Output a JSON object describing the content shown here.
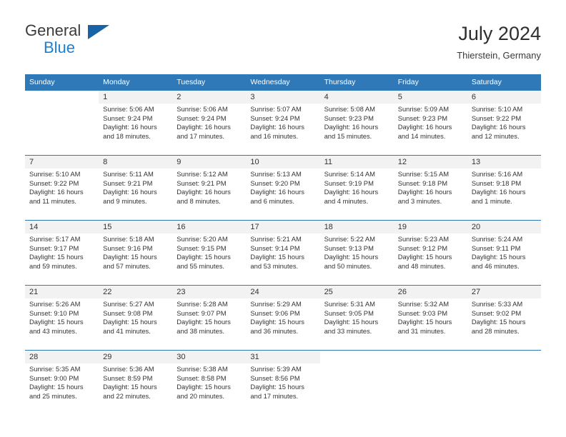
{
  "brand": {
    "name_top": "General",
    "name_bottom": "Blue",
    "flag_icon": "triangle-flag-icon",
    "accent_color": "#1f7fd0"
  },
  "header": {
    "title": "July 2024",
    "subtitle": "Thierstein, Germany"
  },
  "theme": {
    "header_bg": "#3079b8",
    "daynum_bg": "#f2f2f2",
    "text_color": "#333333"
  },
  "weekday_headers": [
    "Sunday",
    "Monday",
    "Tuesday",
    "Wednesday",
    "Thursday",
    "Friday",
    "Saturday"
  ],
  "weeks": [
    [
      {
        "day": "",
        "sunrise": "",
        "sunset": "",
        "daylight1": "",
        "daylight2": ""
      },
      {
        "day": "1",
        "sunrise": "Sunrise: 5:06 AM",
        "sunset": "Sunset: 9:24 PM",
        "daylight1": "Daylight: 16 hours",
        "daylight2": "and 18 minutes."
      },
      {
        "day": "2",
        "sunrise": "Sunrise: 5:06 AM",
        "sunset": "Sunset: 9:24 PM",
        "daylight1": "Daylight: 16 hours",
        "daylight2": "and 17 minutes."
      },
      {
        "day": "3",
        "sunrise": "Sunrise: 5:07 AM",
        "sunset": "Sunset: 9:24 PM",
        "daylight1": "Daylight: 16 hours",
        "daylight2": "and 16 minutes."
      },
      {
        "day": "4",
        "sunrise": "Sunrise: 5:08 AM",
        "sunset": "Sunset: 9:23 PM",
        "daylight1": "Daylight: 16 hours",
        "daylight2": "and 15 minutes."
      },
      {
        "day": "5",
        "sunrise": "Sunrise: 5:09 AM",
        "sunset": "Sunset: 9:23 PM",
        "daylight1": "Daylight: 16 hours",
        "daylight2": "and 14 minutes."
      },
      {
        "day": "6",
        "sunrise": "Sunrise: 5:10 AM",
        "sunset": "Sunset: 9:22 PM",
        "daylight1": "Daylight: 16 hours",
        "daylight2": "and 12 minutes."
      }
    ],
    [
      {
        "day": "7",
        "sunrise": "Sunrise: 5:10 AM",
        "sunset": "Sunset: 9:22 PM",
        "daylight1": "Daylight: 16 hours",
        "daylight2": "and 11 minutes."
      },
      {
        "day": "8",
        "sunrise": "Sunrise: 5:11 AM",
        "sunset": "Sunset: 9:21 PM",
        "daylight1": "Daylight: 16 hours",
        "daylight2": "and 9 minutes."
      },
      {
        "day": "9",
        "sunrise": "Sunrise: 5:12 AM",
        "sunset": "Sunset: 9:21 PM",
        "daylight1": "Daylight: 16 hours",
        "daylight2": "and 8 minutes."
      },
      {
        "day": "10",
        "sunrise": "Sunrise: 5:13 AM",
        "sunset": "Sunset: 9:20 PM",
        "daylight1": "Daylight: 16 hours",
        "daylight2": "and 6 minutes."
      },
      {
        "day": "11",
        "sunrise": "Sunrise: 5:14 AM",
        "sunset": "Sunset: 9:19 PM",
        "daylight1": "Daylight: 16 hours",
        "daylight2": "and 4 minutes."
      },
      {
        "day": "12",
        "sunrise": "Sunrise: 5:15 AM",
        "sunset": "Sunset: 9:18 PM",
        "daylight1": "Daylight: 16 hours",
        "daylight2": "and 3 minutes."
      },
      {
        "day": "13",
        "sunrise": "Sunrise: 5:16 AM",
        "sunset": "Sunset: 9:18 PM",
        "daylight1": "Daylight: 16 hours",
        "daylight2": "and 1 minute."
      }
    ],
    [
      {
        "day": "14",
        "sunrise": "Sunrise: 5:17 AM",
        "sunset": "Sunset: 9:17 PM",
        "daylight1": "Daylight: 15 hours",
        "daylight2": "and 59 minutes."
      },
      {
        "day": "15",
        "sunrise": "Sunrise: 5:18 AM",
        "sunset": "Sunset: 9:16 PM",
        "daylight1": "Daylight: 15 hours",
        "daylight2": "and 57 minutes."
      },
      {
        "day": "16",
        "sunrise": "Sunrise: 5:20 AM",
        "sunset": "Sunset: 9:15 PM",
        "daylight1": "Daylight: 15 hours",
        "daylight2": "and 55 minutes."
      },
      {
        "day": "17",
        "sunrise": "Sunrise: 5:21 AM",
        "sunset": "Sunset: 9:14 PM",
        "daylight1": "Daylight: 15 hours",
        "daylight2": "and 53 minutes."
      },
      {
        "day": "18",
        "sunrise": "Sunrise: 5:22 AM",
        "sunset": "Sunset: 9:13 PM",
        "daylight1": "Daylight: 15 hours",
        "daylight2": "and 50 minutes."
      },
      {
        "day": "19",
        "sunrise": "Sunrise: 5:23 AM",
        "sunset": "Sunset: 9:12 PM",
        "daylight1": "Daylight: 15 hours",
        "daylight2": "and 48 minutes."
      },
      {
        "day": "20",
        "sunrise": "Sunrise: 5:24 AM",
        "sunset": "Sunset: 9:11 PM",
        "daylight1": "Daylight: 15 hours",
        "daylight2": "and 46 minutes."
      }
    ],
    [
      {
        "day": "21",
        "sunrise": "Sunrise: 5:26 AM",
        "sunset": "Sunset: 9:10 PM",
        "daylight1": "Daylight: 15 hours",
        "daylight2": "and 43 minutes."
      },
      {
        "day": "22",
        "sunrise": "Sunrise: 5:27 AM",
        "sunset": "Sunset: 9:08 PM",
        "daylight1": "Daylight: 15 hours",
        "daylight2": "and 41 minutes."
      },
      {
        "day": "23",
        "sunrise": "Sunrise: 5:28 AM",
        "sunset": "Sunset: 9:07 PM",
        "daylight1": "Daylight: 15 hours",
        "daylight2": "and 38 minutes."
      },
      {
        "day": "24",
        "sunrise": "Sunrise: 5:29 AM",
        "sunset": "Sunset: 9:06 PM",
        "daylight1": "Daylight: 15 hours",
        "daylight2": "and 36 minutes."
      },
      {
        "day": "25",
        "sunrise": "Sunrise: 5:31 AM",
        "sunset": "Sunset: 9:05 PM",
        "daylight1": "Daylight: 15 hours",
        "daylight2": "and 33 minutes."
      },
      {
        "day": "26",
        "sunrise": "Sunrise: 5:32 AM",
        "sunset": "Sunset: 9:03 PM",
        "daylight1": "Daylight: 15 hours",
        "daylight2": "and 31 minutes."
      },
      {
        "day": "27",
        "sunrise": "Sunrise: 5:33 AM",
        "sunset": "Sunset: 9:02 PM",
        "daylight1": "Daylight: 15 hours",
        "daylight2": "and 28 minutes."
      }
    ],
    [
      {
        "day": "28",
        "sunrise": "Sunrise: 5:35 AM",
        "sunset": "Sunset: 9:00 PM",
        "daylight1": "Daylight: 15 hours",
        "daylight2": "and 25 minutes."
      },
      {
        "day": "29",
        "sunrise": "Sunrise: 5:36 AM",
        "sunset": "Sunset: 8:59 PM",
        "daylight1": "Daylight: 15 hours",
        "daylight2": "and 22 minutes."
      },
      {
        "day": "30",
        "sunrise": "Sunrise: 5:38 AM",
        "sunset": "Sunset: 8:58 PM",
        "daylight1": "Daylight: 15 hours",
        "daylight2": "and 20 minutes."
      },
      {
        "day": "31",
        "sunrise": "Sunrise: 5:39 AM",
        "sunset": "Sunset: 8:56 PM",
        "daylight1": "Daylight: 15 hours",
        "daylight2": "and 17 minutes."
      },
      {
        "day": "",
        "sunrise": "",
        "sunset": "",
        "daylight1": "",
        "daylight2": ""
      },
      {
        "day": "",
        "sunrise": "",
        "sunset": "",
        "daylight1": "",
        "daylight2": ""
      },
      {
        "day": "",
        "sunrise": "",
        "sunset": "",
        "daylight1": "",
        "daylight2": ""
      }
    ]
  ]
}
